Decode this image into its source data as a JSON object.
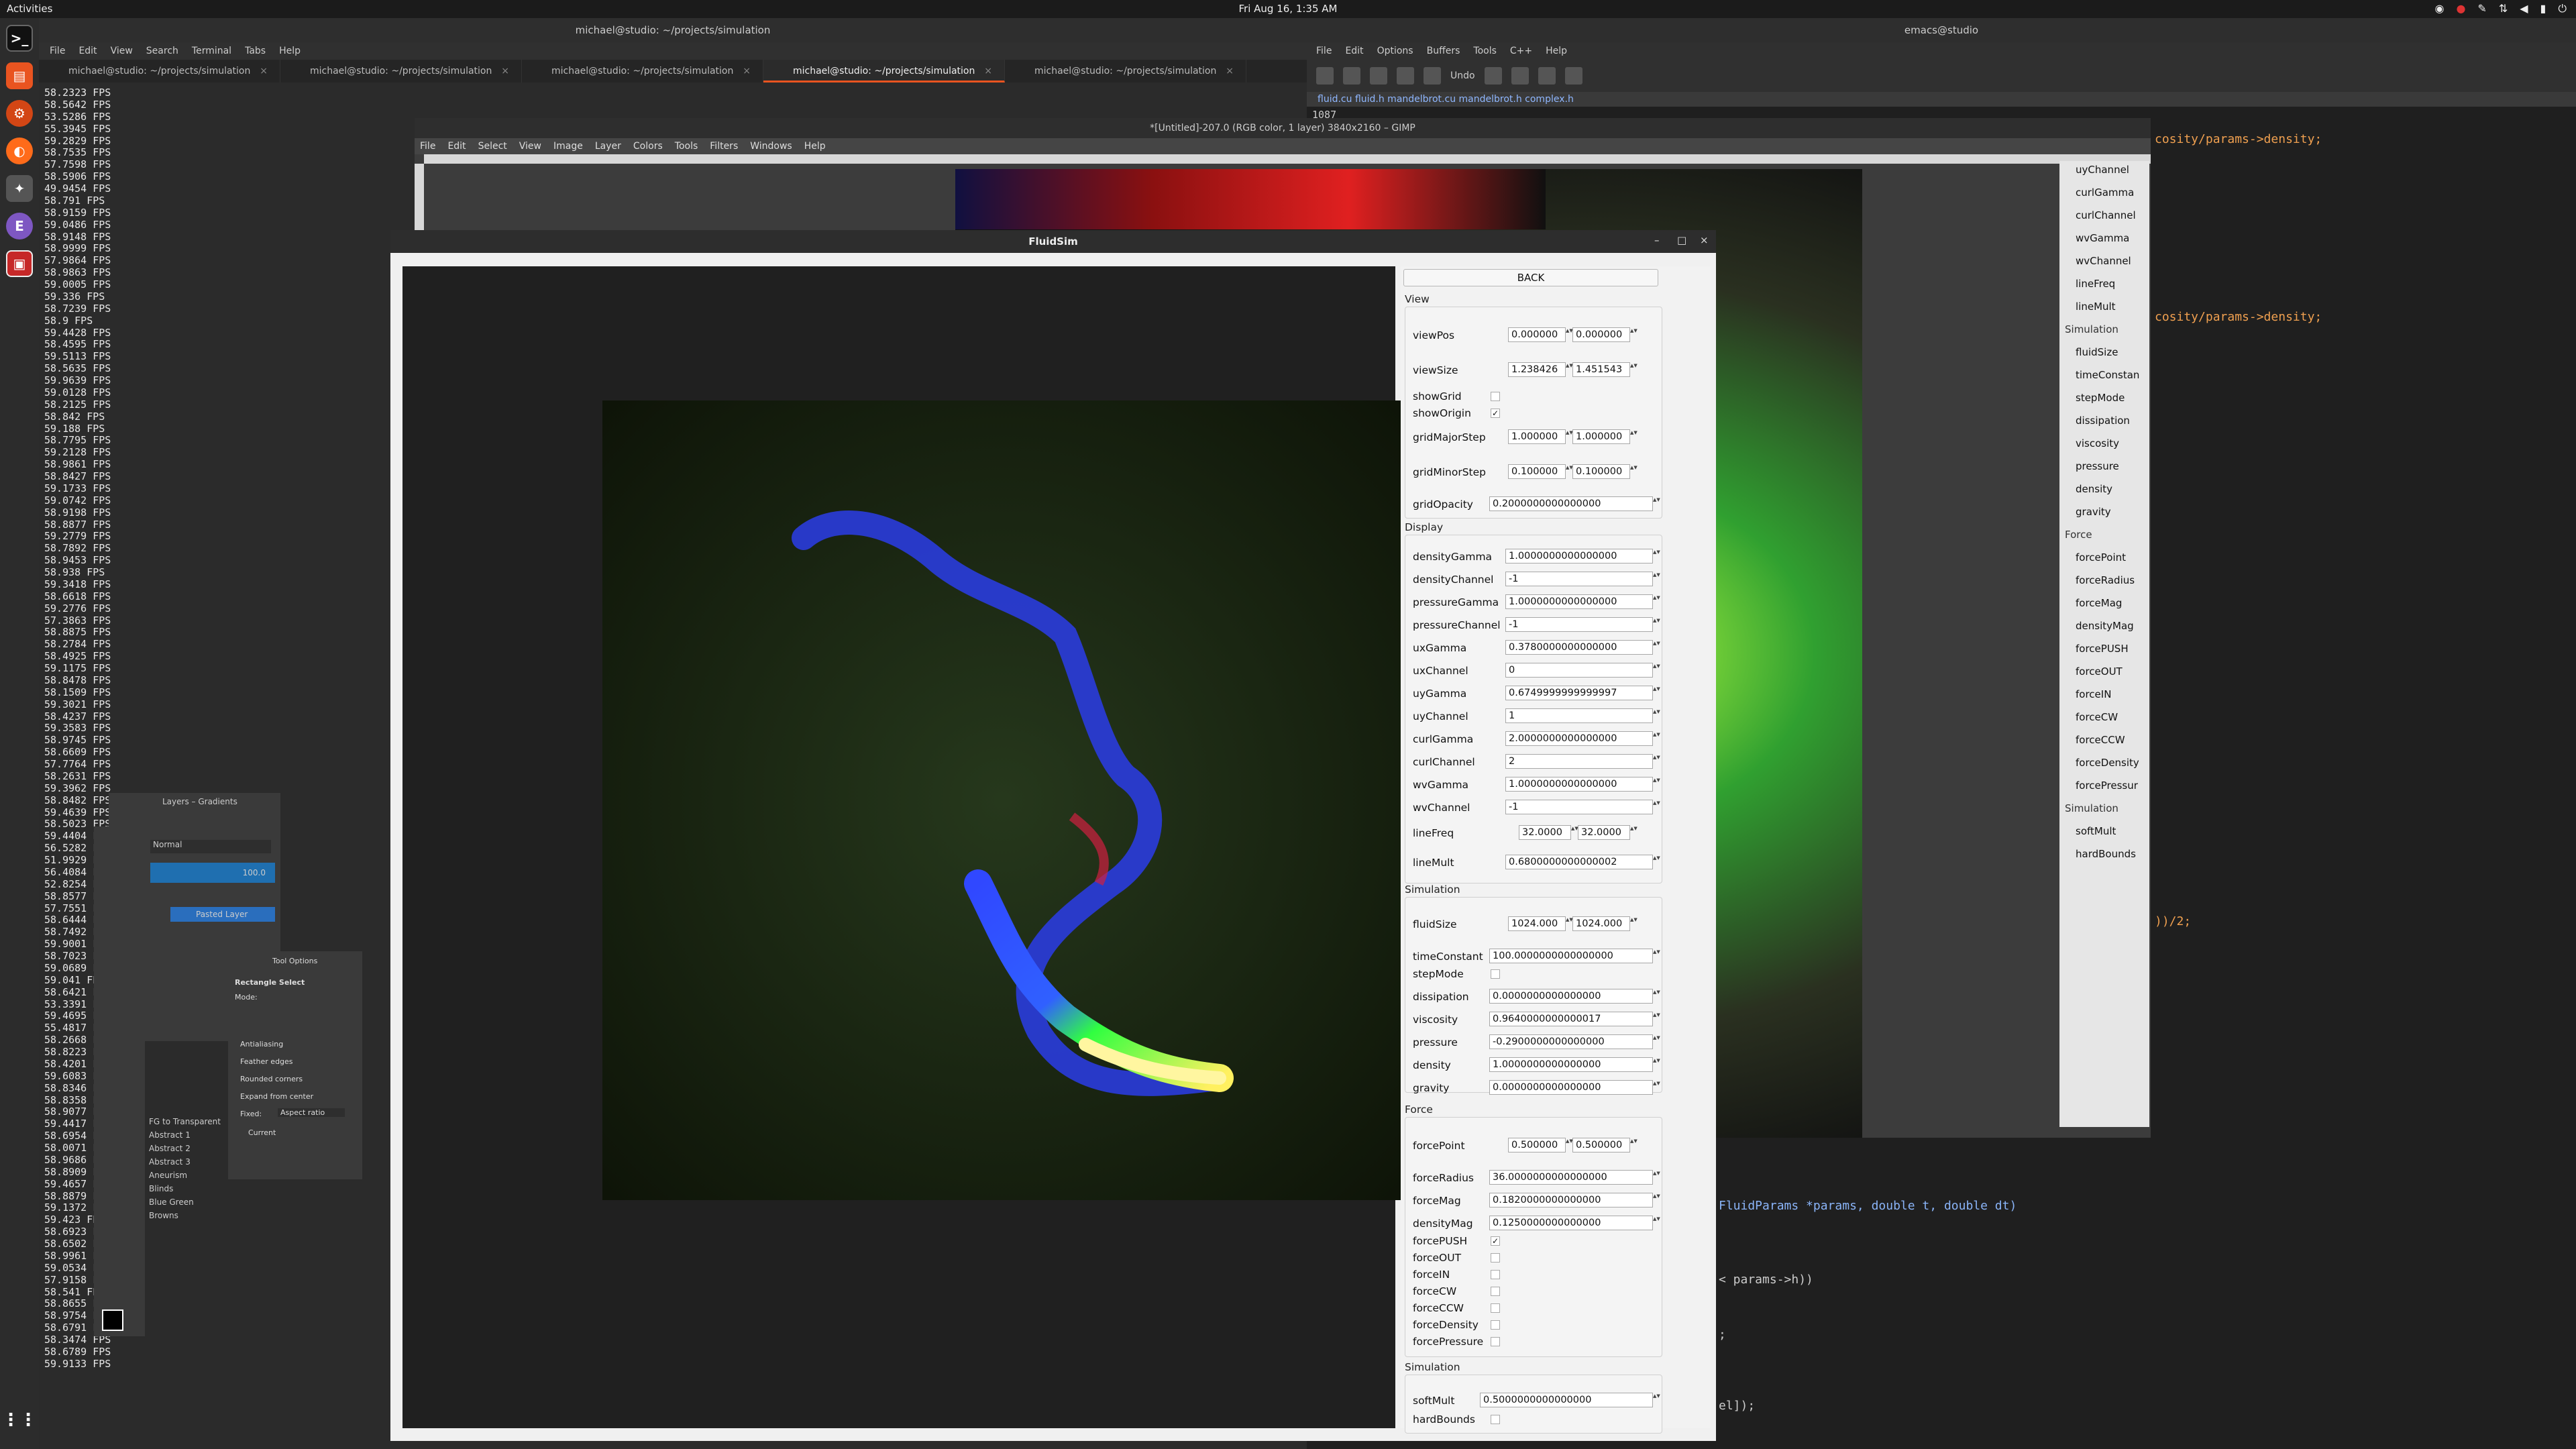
{
  "topbar": {
    "activities": "Activities",
    "clock": "Fri Aug 16, 1:35 AM"
  },
  "terminal": {
    "title": "michael@studio: ~/projects/simulation",
    "menu": [
      "File",
      "Edit",
      "View",
      "Search",
      "Terminal",
      "Tabs",
      "Help"
    ],
    "tabs": [
      "michael@studio: ~/projects/simulation",
      "michael@studio: ~/projects/simulation",
      "michael@studio: ~/projects/simulation",
      "michael@studio: ~/projects/simulation",
      "michael@studio: ~/projects/simulation"
    ],
    "fps_lines": [
      "58.2323 FPS",
      "58.5642 FPS",
      "53.5286 FPS",
      "55.3945 FPS",
      "59.2829 FPS",
      "58.7535 FPS",
      "57.7598 FPS",
      "58.5906 FPS",
      "49.9454 FPS",
      "58.791 FPS",
      "58.9159 FPS",
      "59.0486 FPS",
      "58.9148 FPS",
      "58.9999 FPS",
      "57.9864 FPS",
      "58.9863 FPS",
      "59.0005 FPS",
      "59.336 FPS",
      "58.7239 FPS",
      "58.9 FPS",
      "59.4428 FPS",
      "58.4595 FPS",
      "59.5113 FPS",
      "58.5635 FPS",
      "59.9639 FPS",
      "59.0128 FPS",
      "58.2125 FPS",
      "58.842 FPS",
      "59.188 FPS",
      "58.7795 FPS",
      "59.2128 FPS",
      "58.9861 FPS",
      "58.8427 FPS",
      "59.1733 FPS",
      "59.0742 FPS",
      "58.9198 FPS",
      "58.8877 FPS",
      "59.2779 FPS",
      "58.7892 FPS",
      "58.9453 FPS",
      "58.938 FPS",
      "59.3418 FPS",
      "58.6618 FPS",
      "59.2776 FPS",
      "57.3863 FPS",
      "58.8875 FPS",
      "58.2784 FPS",
      "58.4925 FPS",
      "59.1175 FPS",
      "58.8478 FPS",
      "58.1509 FPS",
      "59.3021 FPS",
      "58.4237 FPS",
      "59.3583 FPS",
      "58.9745 FPS",
      "58.6609 FPS",
      "57.7764 FPS",
      "58.2631 FPS",
      "59.3962 FPS",
      "58.8482 FPS",
      "59.4639 FPS",
      "58.5023 FPS",
      "59.4404 FPS",
      "56.5282 FPS",
      "51.9929 FPS",
      "56.4084 FPS",
      "52.8254 FPS",
      "58.8577 FPS",
      "57.7551 FPS",
      "58.6444 FPS",
      "58.7492 FPS",
      "59.9001 FPS",
      "58.7023 FPS",
      "59.0689 FPS",
      "59.041 FPS",
      "58.6421 FPS",
      "53.3391 FPS",
      "59.4695 FPS",
      "55.4817 FPS",
      "58.2668 FPS",
      "58.8223 FPS",
      "58.4201 FPS",
      "59.6083 FPS",
      "58.8346 FPS",
      "58.8358 FPS",
      "58.9077 FPS",
      "59.4417 FPS",
      "58.6954 FPS",
      "58.0071 FPS",
      "58.9686 FPS",
      "58.8909 FPS",
      "59.4657 FPS",
      "58.8879 FPS",
      "59.1372 FPS",
      "59.423 FPS",
      "58.6923 FPS",
      "58.6502 FPS",
      "58.9961 FPS",
      "59.0534 FPS",
      "57.9158 FPS",
      "58.541 FPS",
      "58.8655 FPS",
      "58.9754 FPS",
      "58.6791 FPS",
      "58.3474 FPS",
      "58.6789 FPS",
      "59.9133 FPS"
    ]
  },
  "emacs": {
    "title": "emacs@studio",
    "menu": [
      "File",
      "Edit",
      "Options",
      "Buffers",
      "Tools",
      "C++",
      "Help"
    ],
    "undo": "Undo",
    "tabline": "fluid.cu  fluid.h  mandelbrot.cu  mandelbrot.h  complex.h",
    "line_number": "1087",
    "code_lines": [
      "cosity/params->density;",
      "cosity/params->density;",
      "))/2;",
      "FluidParams *params, double t, double dt)",
      "< params->h))",
      ";",
      "el]);"
    ]
  },
  "gimp": {
    "title": "*[Untitled]-207.0 (RGB color, 1 layer) 3840x2160 – GIMP",
    "menu": [
      "File",
      "Edit",
      "Select",
      "View",
      "Image",
      "Layer",
      "Colors",
      "Tools",
      "Filters",
      "Windows",
      "Help"
    ],
    "panel_items": [
      {
        "type": "item",
        "text": "uyChannel"
      },
      {
        "type": "item",
        "text": "curlGamma"
      },
      {
        "type": "item",
        "text": "curlChannel"
      },
      {
        "type": "item",
        "text": "wvGamma"
      },
      {
        "type": "item",
        "text": "wvChannel"
      },
      {
        "type": "item",
        "text": "lineFreq"
      },
      {
        "type": "item",
        "text": "lineMult"
      },
      {
        "type": "head",
        "text": "Simulation"
      },
      {
        "type": "item",
        "text": "fluidSize"
      },
      {
        "type": "item",
        "text": "timeConstan"
      },
      {
        "type": "item",
        "text": "stepMode"
      },
      {
        "type": "item",
        "text": "dissipation"
      },
      {
        "type": "item",
        "text": "viscosity"
      },
      {
        "type": "item",
        "text": "pressure"
      },
      {
        "type": "item",
        "text": "density"
      },
      {
        "type": "item",
        "text": "gravity"
      },
      {
        "type": "head",
        "text": "Force"
      },
      {
        "type": "item",
        "text": "forcePoint"
      },
      {
        "type": "item",
        "text": "forceRadius"
      },
      {
        "type": "item",
        "text": "forceMag"
      },
      {
        "type": "item",
        "text": "densityMag"
      },
      {
        "type": "item",
        "text": "forcePUSH"
      },
      {
        "type": "item",
        "text": "forceOUT"
      },
      {
        "type": "item",
        "text": "forceIN"
      },
      {
        "type": "item",
        "text": "forceCW"
      },
      {
        "type": "item",
        "text": "forceCCW"
      },
      {
        "type": "item",
        "text": "forceDensity"
      },
      {
        "type": "item",
        "text": "forcePressur"
      },
      {
        "type": "head",
        "text": "Simulation"
      },
      {
        "type": "item",
        "text": "softMult"
      },
      {
        "type": "item",
        "text": "hardBounds"
      }
    ],
    "layers_title": "Layers – Gradients",
    "layer_mode": "Normal",
    "layer_opacity": "100.0",
    "layer_name": "Pasted Layer",
    "gradients": [
      "FG to Transparent",
      "Abstract 1",
      "Abstract 2",
      "Abstract 3",
      "Aneurism",
      "Blinds",
      "Blue Green",
      "Browns"
    ],
    "tool_options_title": "Tool Options",
    "tool_name": "Rectangle Select",
    "mode_label": "Mode:",
    "tool_checks": [
      "Antialiasing",
      "Feather edges",
      "Rounded corners",
      "Expand from center"
    ],
    "fixed_label": "Fixed:",
    "fixed_value": "Aspect ratio",
    "current_label": "Current"
  },
  "fluidsim": {
    "title": "FluidSim",
    "back": "BACK",
    "sections": {
      "view": "View",
      "display": "Display",
      "simulation": "Simulation",
      "force": "Force",
      "simulation2": "Simulation"
    },
    "view": {
      "viewPos": [
        "0.000000",
        "0.000000"
      ],
      "viewSize": [
        "1.238426",
        "1.451543"
      ],
      "showGrid": false,
      "showOrigin": true,
      "gridMajorStep": [
        "1.000000",
        "1.000000"
      ],
      "gridMinorStep": [
        "0.100000",
        "0.100000"
      ],
      "gridOpacity": "0.2000000000000000"
    },
    "display": {
      "densityGamma": "1.0000000000000000",
      "densityChannel": "-1",
      "pressureGamma": "1.0000000000000000",
      "pressureChannel": "-1",
      "uxGamma": "0.3780000000000000",
      "uxChannel": "0",
      "uyGamma": "0.6749999999999997",
      "uyChannel": "1",
      "curlGamma": "2.0000000000000000",
      "curlChannel": "2",
      "wvGamma": "1.0000000000000000",
      "wvChannel": "-1",
      "lineFreq": [
        "32.0000",
        "32.0000"
      ],
      "lineMult": "0.6800000000000002"
    },
    "simulation": {
      "fluidSize": [
        "1024.000",
        "1024.000"
      ],
      "timeConstant": "100.0000000000000000",
      "stepMode": false,
      "dissipation": "0.0000000000000000",
      "viscosity": "0.9640000000000017",
      "pressure": "-0.2900000000000000",
      "density": "1.0000000000000000",
      "gravity": "0.0000000000000000"
    },
    "force": {
      "forcePoint": [
        "0.500000",
        "0.500000"
      ],
      "forceRadius": "36.0000000000000000",
      "forceMag": "0.1820000000000000",
      "densityMag": "0.1250000000000000",
      "forcePUSH": true,
      "forceOUT": false,
      "forceIN": false,
      "forceCW": false,
      "forceCCW": false,
      "forceDensity": false,
      "forcePressure": false
    },
    "simulation2": {
      "softMult": "0.5000000000000000",
      "hardBounds": false
    },
    "labels": {
      "viewPos": "viewPos",
      "viewSize": "viewSize",
      "showGrid": "showGrid",
      "showOrigin": "showOrigin",
      "gridMajorStep": "gridMajorStep",
      "gridMinorStep": "gridMinorStep",
      "gridOpacity": "gridOpacity",
      "densityGamma": "densityGamma",
      "densityChannel": "densityChannel",
      "pressureGamma": "pressureGamma",
      "pressureChannel": "pressureChannel",
      "uxGamma": "uxGamma",
      "uxChannel": "uxChannel",
      "uyGamma": "uyGamma",
      "uyChannel": "uyChannel",
      "curlGamma": "curlGamma",
      "curlChannel": "curlChannel",
      "wvGamma": "wvGamma",
      "wvChannel": "wvChannel",
      "lineFreq": "lineFreq",
      "lineMult": "lineMult",
      "fluidSize": "fluidSize",
      "timeConstant": "timeConstant",
      "stepMode": "stepMode",
      "dissipation": "dissipation",
      "viscosity": "viscosity",
      "pressure": "pressure",
      "density": "density",
      "gravity": "gravity",
      "forcePoint": "forcePoint",
      "forceRadius": "forceRadius",
      "forceMag": "forceMag",
      "densityMag": "densityMag",
      "forcePUSH": "forcePUSH",
      "forceOUT": "forceOUT",
      "forceIN": "forceIN",
      "forceCW": "forceCW",
      "forceCCW": "forceCCW",
      "forceDensity": "forceDensity",
      "forcePressure": "forcePressure",
      "softMult": "softMult",
      "hardBounds": "hardBounds"
    }
  }
}
